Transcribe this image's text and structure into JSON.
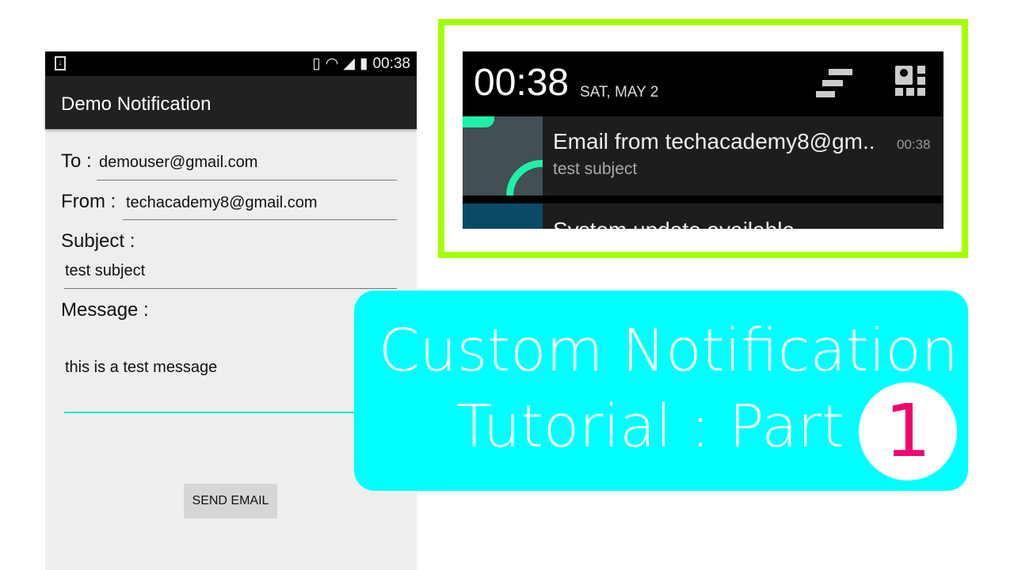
{
  "phone": {
    "status_time": "00:38",
    "app_title": "Demo Notification",
    "to_label": "To :",
    "to_value": "demouser@gmail.com",
    "from_label": "From :",
    "from_value": "techacademy8@gmail.com",
    "subject_label": "Subject :",
    "subject_value": "test subject",
    "message_label": "Message :",
    "message_value": "this is a test message",
    "send_button": "SEND EMAIL"
  },
  "notification_panel": {
    "time": "00:38",
    "date": "SAT, MAY 2",
    "items": [
      {
        "title": "Email from techacademy8@gm..",
        "text": "test subject",
        "time": "00:38"
      },
      {
        "title": "System update available"
      }
    ]
  },
  "banner": {
    "line1": "Custom Notification",
    "line2": "Tutorial : Part",
    "part_number": "1"
  },
  "colors": {
    "frame": "#a6ff00",
    "banner": "#00ffff",
    "accent_line": "#00e5d4",
    "number": "#f0066e"
  }
}
